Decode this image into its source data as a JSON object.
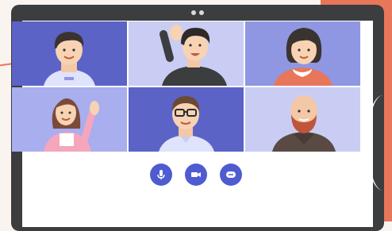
{
  "colors": {
    "accent": "#e8765a",
    "laptop_frame": "#3b3d3f",
    "control_button": "#4f5bd0"
  },
  "participants": [
    {
      "icon": "participant-man-blue-shirt",
      "tile_color": "#5b63c7"
    },
    {
      "icon": "participant-man-waving-curly-hair",
      "tile_color": "#c9cdf3"
    },
    {
      "icon": "participant-woman-pink-sweater",
      "tile_color": "#8f97e2"
    },
    {
      "icon": "participant-woman-waving-long-hair",
      "tile_color": "#a8aeee"
    },
    {
      "icon": "participant-man-glasses",
      "tile_color": "#5b63c7"
    },
    {
      "icon": "participant-bald-bearded-man",
      "tile_color": "#c9cdf3"
    }
  ],
  "controls": [
    {
      "icon": "microphone-icon"
    },
    {
      "icon": "video-camera-icon"
    },
    {
      "icon": "chat-icon"
    }
  ]
}
